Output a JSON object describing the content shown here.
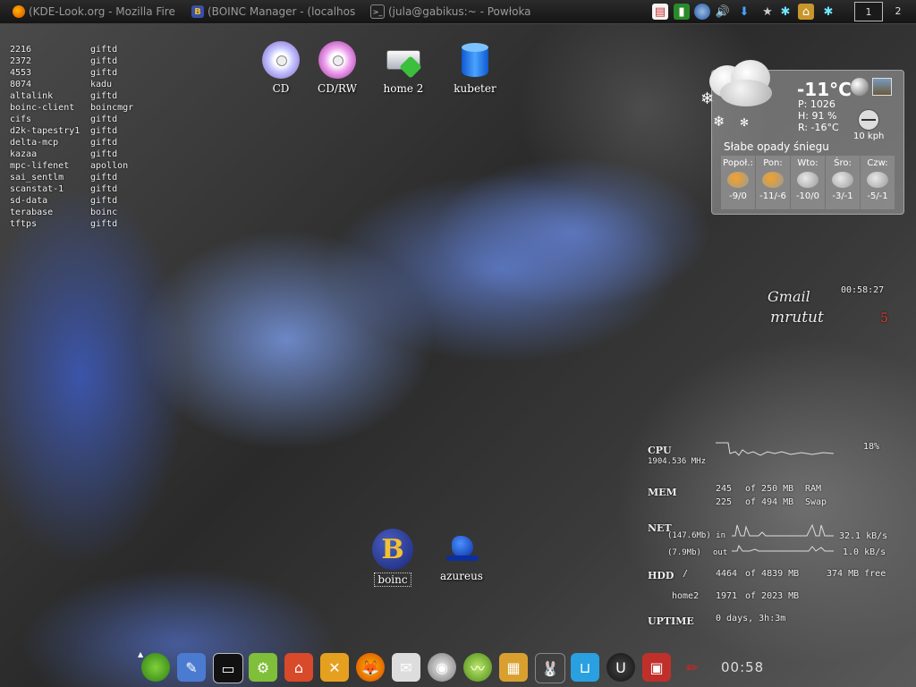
{
  "taskbar": {
    "tasks": [
      {
        "label": "(KDE-Look.org - Mozilla Fire",
        "icon": "firefox-icon",
        "color": "#e66000"
      },
      {
        "label": "(BOINC Manager - (localhos",
        "icon": "boinc-icon",
        "color": "#3a4fa6"
      },
      {
        "label": "(jula@gabikus:~ - Powłoka",
        "icon": "terminal-icon",
        "color": "#333333"
      }
    ],
    "tray": [
      "kde-look-icon",
      "battery-icon",
      "network-icon",
      "volume-icon",
      "download-icon",
      "star-icon",
      "snowflake-icon",
      "home-icon",
      "snowflake2-icon"
    ],
    "pager": [
      "1",
      "2"
    ]
  },
  "processes": [
    [
      "2216",
      "giftd"
    ],
    [
      "2372",
      "giftd"
    ],
    [
      "4553",
      "giftd"
    ],
    [
      "8074",
      "kadu"
    ],
    [
      "altalink",
      "giftd"
    ],
    [
      "boinc-client",
      "boincmgr"
    ],
    [
      "cifs",
      "giftd"
    ],
    [
      "d2k-tapestry1",
      "giftd"
    ],
    [
      "delta-mcp",
      "giftd"
    ],
    [
      "kazaa",
      "giftd"
    ],
    [
      "mpc-lifenet",
      "apollon"
    ],
    [
      "sai_sentlm",
      "giftd"
    ],
    [
      "scanstat-1",
      "giftd"
    ],
    [
      "sd-data",
      "giftd"
    ],
    [
      "terabase",
      "boinc"
    ],
    [
      "tftps",
      "giftd"
    ]
  ],
  "desktop_icons": {
    "cd": "CD",
    "cdrw": "CD/RW",
    "home2": "home 2",
    "kubeter": "kubeter",
    "boinc": "boinc",
    "azureus": "azureus"
  },
  "weather": {
    "temp": "-11°C",
    "pressure": "P: 1026",
    "humidity": "H: 91 %",
    "realfeel": "R: -16°C",
    "wind": "10 kph",
    "description": "Słabe opady śniegu",
    "forecast": [
      {
        "day": "Popoł.:",
        "temp": "-9/0"
      },
      {
        "day": "Pon:",
        "temp": "-11/-6"
      },
      {
        "day": "Wto:",
        "temp": "-10/0"
      },
      {
        "day": "Śro:",
        "temp": "-3/-1"
      },
      {
        "day": "Czw:",
        "temp": "-5/-1"
      }
    ]
  },
  "gmail": {
    "title": "Gmail",
    "user": "mrutut",
    "count": "5",
    "time": "00:58:27"
  },
  "sysmon": {
    "cpu_label": "CPU",
    "cpu_freq": "1904.536 MHz",
    "cpu_pct": "18%",
    "mem_label": "MEM",
    "ram_used": "245",
    "ram_of": "of 250 MB",
    "ram_name": "RAM",
    "swap_used": "225",
    "swap_of": "of 494 MB",
    "swap_name": "Swap",
    "net_label": "NET",
    "net_in_total": "(147.6Mb) in",
    "net_in_rate": "32.1 kB/s",
    "net_out_total": "(7.9Mb)",
    "net_out_label": "out",
    "net_out_rate": "1.0 kB/s",
    "hdd_label": "HDD",
    "hdd_root": "/",
    "hdd_root_used": "4464",
    "hdd_root_of": "of 4839 MB",
    "hdd_root_free": "374 MB free",
    "hdd_home": "home2",
    "hdd_home_used": "1971",
    "hdd_home_of": "of 2023 MB",
    "uptime_label": "UPTIME",
    "uptime": "0 days, 3h:3m"
  },
  "launcher": [
    "opensuse-icon",
    "kwrite-icon",
    "konsole-icon",
    "kcontrol-icon",
    "home-folder-icon",
    "kmix-icon",
    "firefox-icon",
    "kmail-icon",
    "webcam-icon",
    "amarok-icon",
    "archive-icon",
    "rabbit-icon",
    "k3b-icon",
    "ut-icon",
    "cube-icon",
    "pen-icon"
  ],
  "clock": "00:58"
}
